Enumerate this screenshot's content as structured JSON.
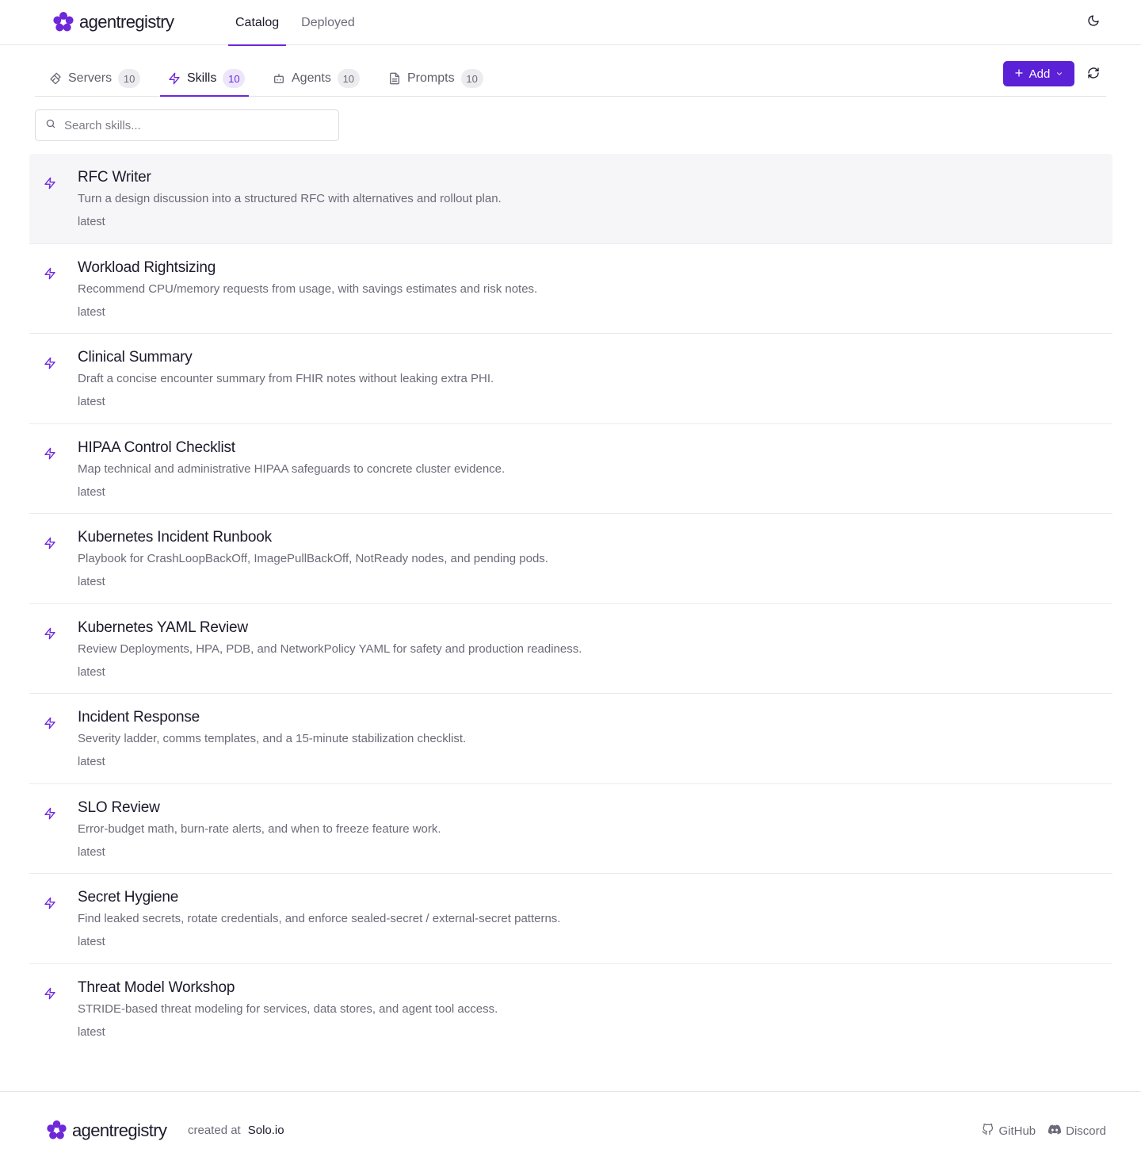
{
  "header": {
    "brand": "agentregistry",
    "nav": [
      {
        "label": "Catalog",
        "active": true
      },
      {
        "label": "Deployed",
        "active": false
      }
    ],
    "theme_icon": "moon-icon"
  },
  "tabs": [
    {
      "label": "Servers",
      "count": "10",
      "icon": "server-icon"
    },
    {
      "label": "Skills",
      "count": "10",
      "icon": "zap-icon",
      "active": true
    },
    {
      "label": "Agents",
      "count": "10",
      "icon": "bot-icon"
    },
    {
      "label": "Prompts",
      "count": "10",
      "icon": "file-text-icon"
    }
  ],
  "toolbar": {
    "add_label": "Add",
    "refresh_icon": "refresh-icon"
  },
  "search": {
    "placeholder": "Search skills..."
  },
  "skills": [
    {
      "title": "RFC Writer",
      "description": "Turn a design discussion into a structured RFC with alternatives and rollout plan.",
      "version": "latest"
    },
    {
      "title": "Workload Rightsizing",
      "description": "Recommend CPU/memory requests from usage, with savings estimates and risk notes.",
      "version": "latest"
    },
    {
      "title": "Clinical Summary",
      "description": "Draft a concise encounter summary from FHIR notes without leaking extra PHI.",
      "version": "latest"
    },
    {
      "title": "HIPAA Control Checklist",
      "description": "Map technical and administrative HIPAA safeguards to concrete cluster evidence.",
      "version": "latest"
    },
    {
      "title": "Kubernetes Incident Runbook",
      "description": "Playbook for CrashLoopBackOff, ImagePullBackOff, NotReady nodes, and pending pods.",
      "version": "latest"
    },
    {
      "title": "Kubernetes YAML Review",
      "description": "Review Deployments, HPA, PDB, and NetworkPolicy YAML for safety and production readiness.",
      "version": "latest"
    },
    {
      "title": "Incident Response",
      "description": "Severity ladder, comms templates, and a 15-minute stabilization checklist.",
      "version": "latest"
    },
    {
      "title": "SLO Review",
      "description": "Error-budget math, burn-rate alerts, and when to freeze feature work.",
      "version": "latest"
    },
    {
      "title": "Secret Hygiene",
      "description": "Find leaked secrets, rotate credentials, and enforce sealed-secret / external-secret patterns.",
      "version": "latest"
    },
    {
      "title": "Threat Model Workshop",
      "description": "STRIDE-based threat modeling for services, data stores, and agent tool access.",
      "version": "latest"
    }
  ],
  "footer": {
    "brand": "agentregistry",
    "created_at": "created at",
    "org": "Solo.io",
    "links": [
      {
        "label": "GitHub",
        "icon": "github-icon"
      },
      {
        "label": "Discord",
        "icon": "discord-icon"
      }
    ]
  },
  "colors": {
    "accent": "#5b21d6",
    "accent_text": "#6d28d9",
    "muted_text": "#6b6b78"
  }
}
